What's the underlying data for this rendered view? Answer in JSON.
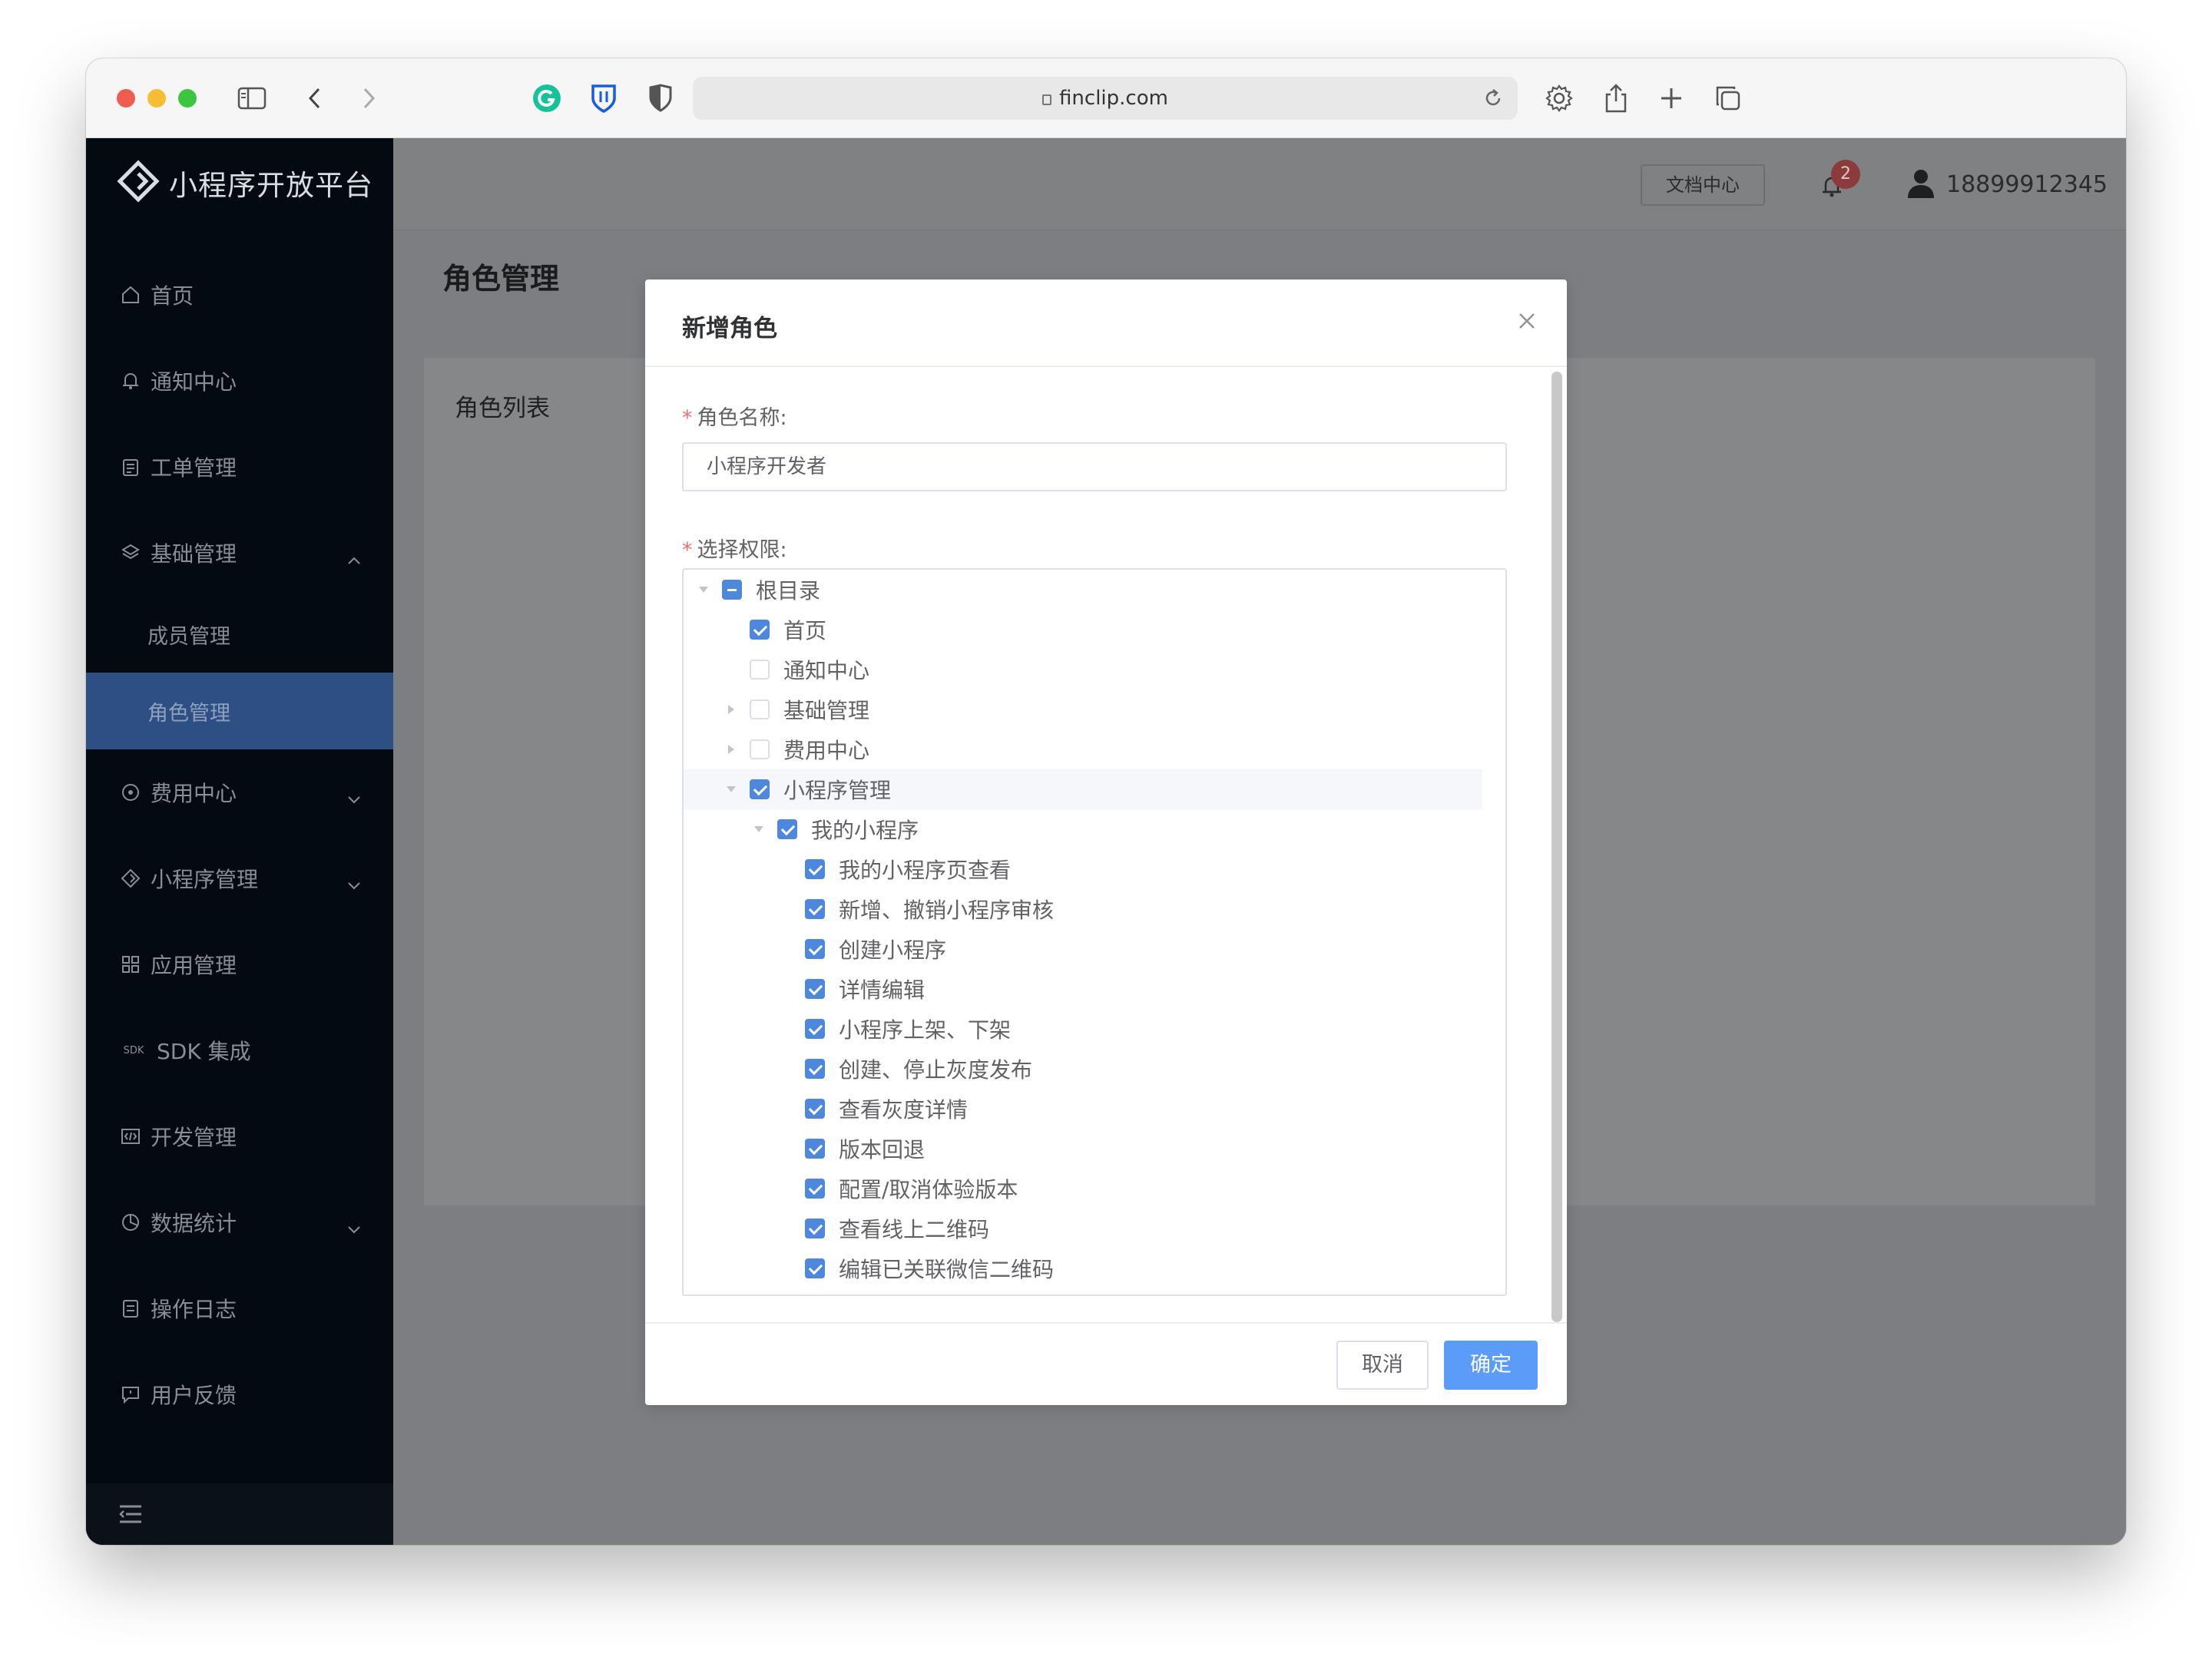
{
  "browser": {
    "url": "finclip.com"
  },
  "sidebar": {
    "logo_text": "小程序开放平台",
    "items": [
      {
        "label": "首页",
        "icon": "home-icon"
      },
      {
        "label": "通知中心",
        "icon": "bell-icon"
      },
      {
        "label": "工单管理",
        "icon": "clipboard-icon"
      },
      {
        "label": "基础管理",
        "icon": "layers-icon",
        "expanded": true
      },
      {
        "label": "成员管理"
      },
      {
        "label": "角色管理",
        "active": true
      },
      {
        "label": "费用中心",
        "icon": "coin-icon"
      },
      {
        "label": "小程序管理",
        "icon": "diamond-icon"
      },
      {
        "label": "应用管理",
        "icon": "grid-icon"
      },
      {
        "label": "SDK 集成",
        "icon": "sdk-icon",
        "icon_text": "SDK"
      },
      {
        "label": "开发管理",
        "icon": "code-icon"
      },
      {
        "label": "数据统计",
        "icon": "pie-chart-icon"
      },
      {
        "label": "操作日志",
        "icon": "log-icon"
      },
      {
        "label": "用户反馈",
        "icon": "feedback-icon"
      }
    ]
  },
  "header": {
    "docs_button": "文档中心",
    "notification_count": "2",
    "user_phone": "18899912345"
  },
  "page": {
    "title": "角色管理",
    "card_title": "角色列表"
  },
  "modal": {
    "title": "新增角色",
    "name_label": "角色名称:",
    "name_value": "小程序开发者",
    "permissions_label": "选择权限:",
    "cancel_label": "取消",
    "confirm_label": "确定",
    "tree": [
      {
        "label": "根目录",
        "level": 0,
        "state": "partial",
        "caret": "down"
      },
      {
        "label": "首页",
        "level": 1,
        "state": "checked",
        "caret": "none"
      },
      {
        "label": "通知中心",
        "level": 1,
        "state": "unchecked",
        "caret": "none"
      },
      {
        "label": "基础管理",
        "level": 1,
        "state": "unchecked",
        "caret": "right"
      },
      {
        "label": "费用中心",
        "level": 1,
        "state": "unchecked",
        "caret": "right"
      },
      {
        "label": "小程序管理",
        "level": 1,
        "state": "checked",
        "caret": "down",
        "highlight": true
      },
      {
        "label": "我的小程序",
        "level": 2,
        "state": "checked",
        "caret": "down"
      },
      {
        "label": "我的小程序页查看",
        "level": 3,
        "state": "checked",
        "caret": "none"
      },
      {
        "label": "新增、撤销小程序审核",
        "level": 3,
        "state": "checked",
        "caret": "none"
      },
      {
        "label": "创建小程序",
        "level": 3,
        "state": "checked",
        "caret": "none"
      },
      {
        "label": "详情编辑",
        "level": 3,
        "state": "checked",
        "caret": "none"
      },
      {
        "label": "小程序上架、下架",
        "level": 3,
        "state": "checked",
        "caret": "none"
      },
      {
        "label": "创建、停止灰度发布",
        "level": 3,
        "state": "checked",
        "caret": "none"
      },
      {
        "label": "查看灰度详情",
        "level": 3,
        "state": "checked",
        "caret": "none"
      },
      {
        "label": "版本回退",
        "level": 3,
        "state": "checked",
        "caret": "none"
      },
      {
        "label": "配置/取消体验版本",
        "level": 3,
        "state": "checked",
        "caret": "none"
      },
      {
        "label": "查看线上二维码",
        "level": 3,
        "state": "checked",
        "caret": "none"
      },
      {
        "label": "编辑已关联微信二维码",
        "level": 3,
        "state": "checked",
        "caret": "none"
      }
    ]
  }
}
